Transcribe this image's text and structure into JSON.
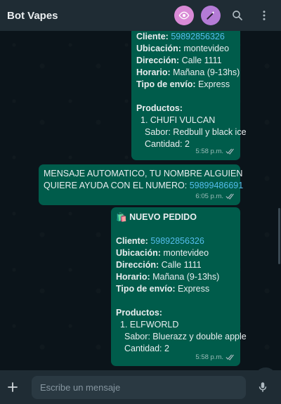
{
  "header": {
    "title": "Bot Vapes",
    "icons": [
      "eye-icon",
      "magic-wand-icon",
      "search-icon",
      "more-vert-icon"
    ]
  },
  "messages": [
    {
      "client_label": "Cliente:",
      "client_phone": "59892856326",
      "location_label": "Ubicación:",
      "location": "montevideo",
      "address_label": "Dirección:",
      "address": "Calle 1111",
      "schedule_label": "Horario:",
      "schedule": "Mañana (9-13hs)",
      "shipping_label": "Tipo de envío:",
      "shipping": "Express",
      "products_label": "Productos:",
      "product_name": "1. CHUFI VULCAN",
      "flavor": "Sabor: Redbull y black ice",
      "quantity": "Cantidad: 2",
      "time": "5:58 p.m."
    },
    {
      "text_line1": "MENSAJE AUTOMATICO, TU NOMBRE ALGUIEN",
      "text_line2": "QUIERE AYUDA CON EL NUMERO:",
      "phone": "59899486691",
      "time": "6:05 p.m."
    },
    {
      "heading_emoji": "🛍️",
      "heading": "NUEVO PEDIDO",
      "client_label": "Cliente:",
      "client_phone": "59892856326",
      "location_label": "Ubicación:",
      "location": "montevideo",
      "address_label": "Dirección:",
      "address": "Calle 1111",
      "schedule_label": "Horario:",
      "schedule": "Mañana (9-13hs)",
      "shipping_label": "Tipo de envío:",
      "shipping": "Express",
      "products_label": "Productos:",
      "product_name": "1. ELFWORLD",
      "flavor": "Sabor: Bluerazz y double apple",
      "quantity": "Cantidad: 2",
      "time": "5:58 p.m."
    }
  ],
  "footer": {
    "placeholder": "Escribe un mensaje"
  },
  "colors": {
    "bubble": "#005c4b",
    "link": "#53bdeb",
    "header": "#1f2c34",
    "background": "#0b141a"
  }
}
